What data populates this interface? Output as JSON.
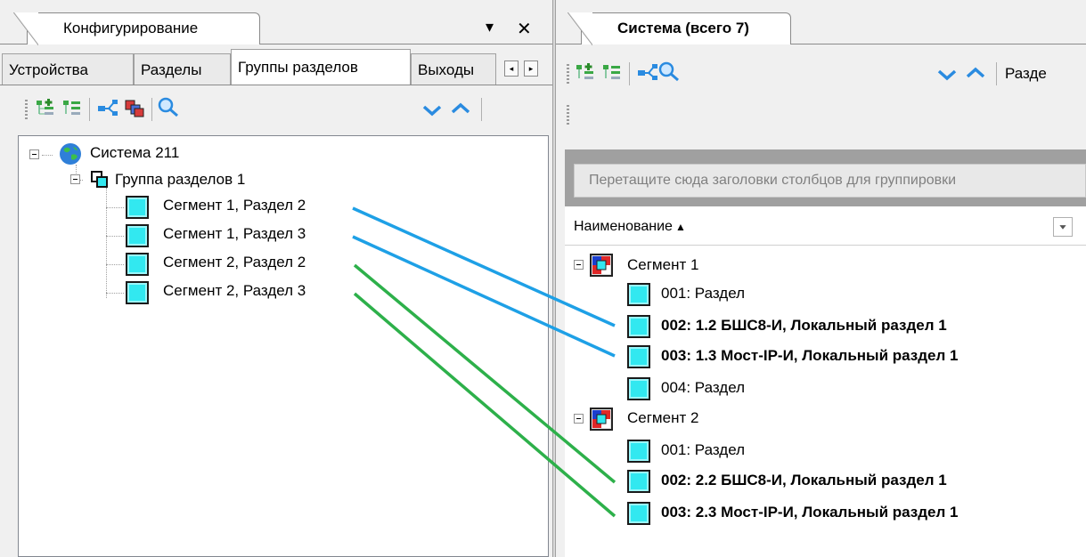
{
  "left": {
    "panel_title": "Конфигурирование",
    "title_controls": {
      "dropdown": "▾",
      "close": "✕"
    },
    "tabs": [
      "Устройства",
      "Разделы",
      "Группы разделов",
      "Выходы"
    ],
    "active_tab": "Группы разделов",
    "scroll_left": "◂",
    "scroll_right": "▸",
    "tree": {
      "root": "Система 211",
      "group": "Группа разделов 1",
      "items": [
        "Сегмент 1, Раздел 2",
        "Сегмент 1, Раздел 3",
        "Сегмент 2, Раздел 2",
        "Сегмент 2, Раздел 3"
      ]
    }
  },
  "right": {
    "panel_title": "Система (всего 7)",
    "toolbar_label": "Разде",
    "group_hint": "Перетащите сюда заголовки столбцов для группировки",
    "column_header": "Наименование",
    "sort_indicator": "▲",
    "segments": [
      {
        "name": "Сегмент 1",
        "rows": [
          {
            "label": "001: Раздел",
            "bold": false
          },
          {
            "label": "002: 1.2 БШС8-И, Локальный раздел 1",
            "bold": true
          },
          {
            "label": "003: 1.3 Мост-IP-И, Локальный раздел 1",
            "bold": true
          },
          {
            "label": "004: Раздел",
            "bold": false
          }
        ]
      },
      {
        "name": "Сегмент 2",
        "rows": [
          {
            "label": "001: Раздел",
            "bold": false
          },
          {
            "label": "002: 2.2 БШС8-И, Локальный раздел 1",
            "bold": true
          },
          {
            "label": "003: 2.3 Мост-IP-И, Локальный раздел 1",
            "bold": true
          }
        ]
      }
    ]
  },
  "colors": {
    "link_blue": "#1ea0e6",
    "link_green": "#2db04a",
    "segment_fill": "#32e8f0",
    "toolbar_arrow": "#2a8be0"
  },
  "icons": [
    "tree-add-icon",
    "tree-remove-icon",
    "tree-link-icon",
    "group-icon",
    "search-icon",
    "arrow-down-icon",
    "arrow-up-icon",
    "globe-icon",
    "section-group-icon",
    "segment-icon",
    "section-icon",
    "column-filter-icon"
  ]
}
